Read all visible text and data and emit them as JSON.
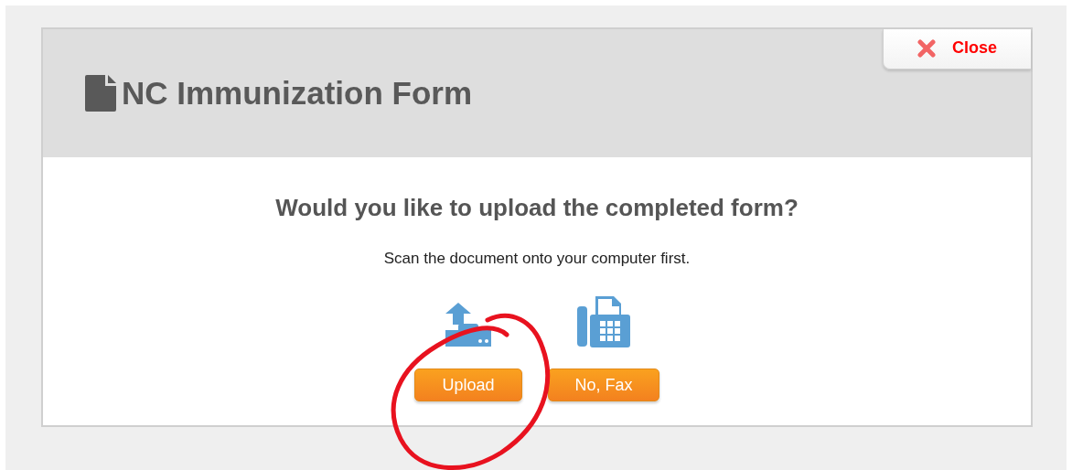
{
  "dialog": {
    "title": "NC Immunization Form",
    "close_button": "Close"
  },
  "question": "Would you like to upload the completed form?",
  "instruction": "Scan the document onto your computer first.",
  "options": [
    {
      "kind": "upload",
      "label": "Upload"
    },
    {
      "kind": "fax",
      "label": "No, Fax"
    }
  ],
  "annotation": {
    "kind": "circle"
  }
}
